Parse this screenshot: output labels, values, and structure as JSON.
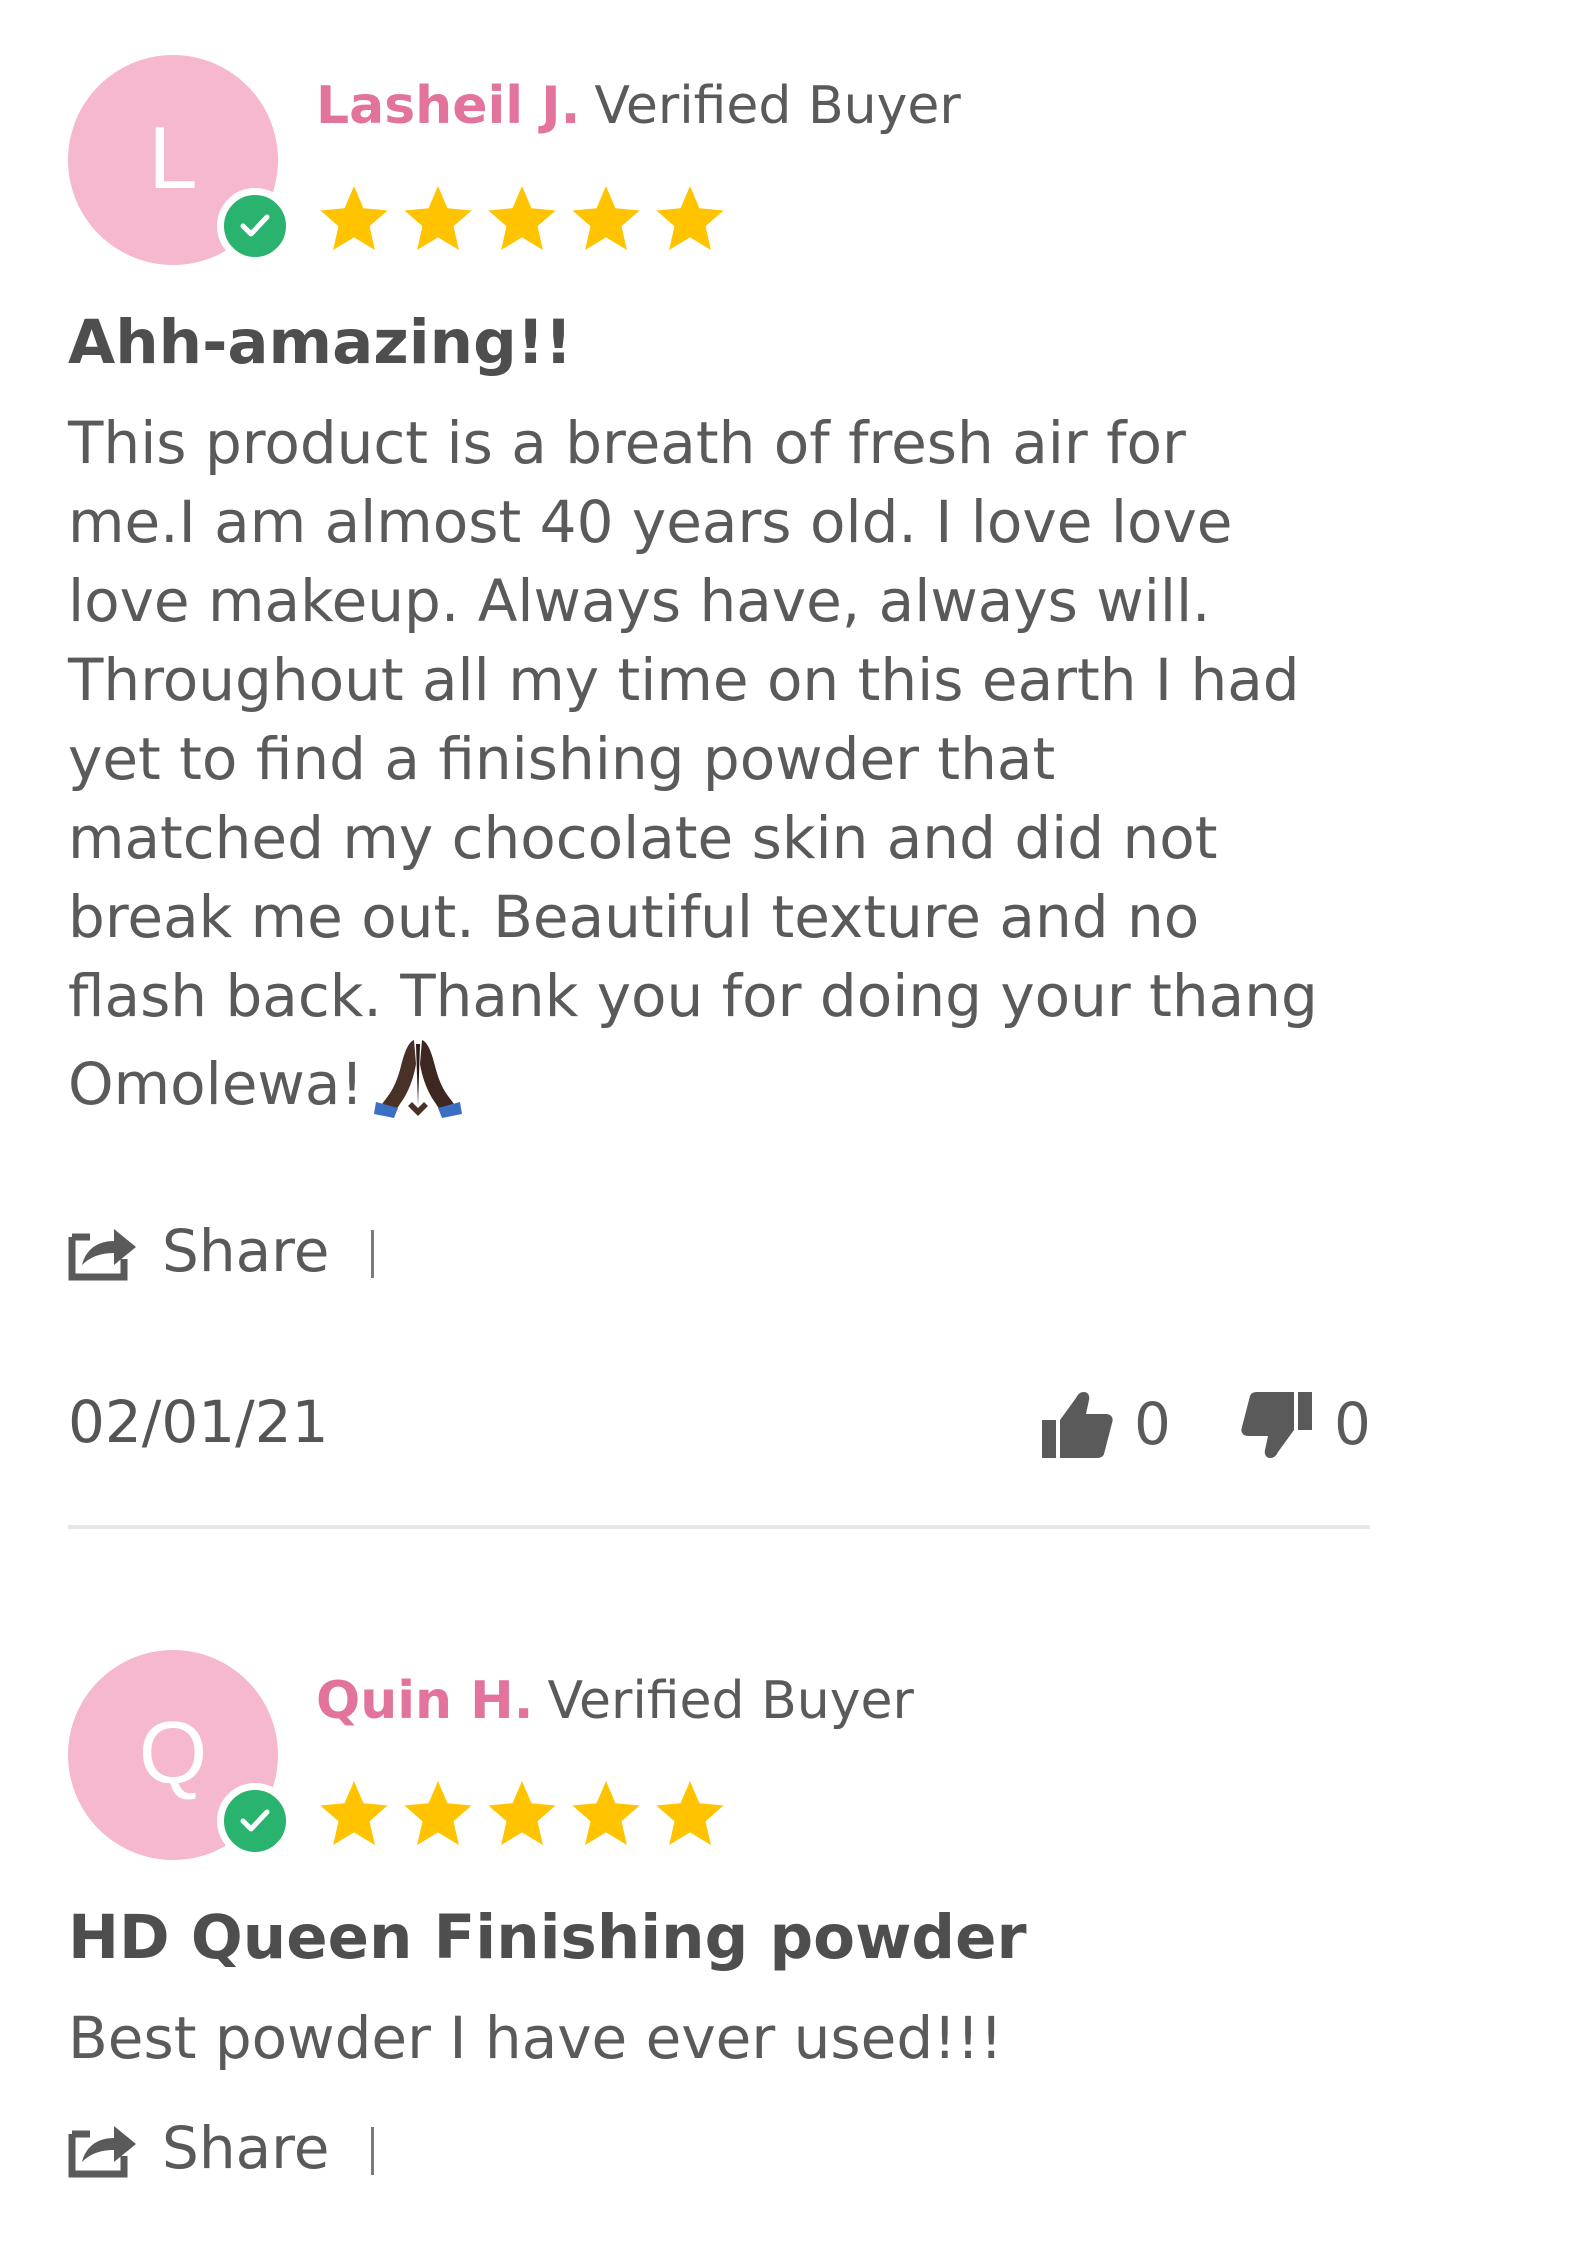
{
  "colors": {
    "avatar_bg": "#f5b8cf",
    "reviewer_name": "#e2739c",
    "verified_badge": "#2ab36e",
    "star": "#ffc300",
    "text": "#595959",
    "separator": "#e6e6e6"
  },
  "reviews": [
    {
      "avatar_letter": "L",
      "name": "Lasheil J.",
      "buyer_label": "Verified Buyer",
      "rating": 5,
      "title": "Ahh-amazing!!",
      "body_lines": [
        "This product is a breath of fresh air for",
        "me.I am almost 40 years old. I love love",
        "love makeup. Always have, always will.",
        "Throughout all my time on this earth I had",
        "yet to find a finishing powder that",
        "matched my chocolate skin and did not",
        "break me out. Beautiful texture and no",
        "flash back. Thank you for doing your thang",
        "Omolewa!"
      ],
      "emoji_icon": "folded-hands-emoji",
      "share_label": "Share",
      "date": "02/01/21",
      "upvotes": "0",
      "downvotes": "0"
    },
    {
      "avatar_letter": "Q",
      "name": "Quin H.",
      "buyer_label": "Verified Buyer",
      "rating": 5,
      "title": "HD Queen Finishing powder",
      "body": "Best powder I have ever used!!!",
      "share_label": "Share"
    }
  ]
}
